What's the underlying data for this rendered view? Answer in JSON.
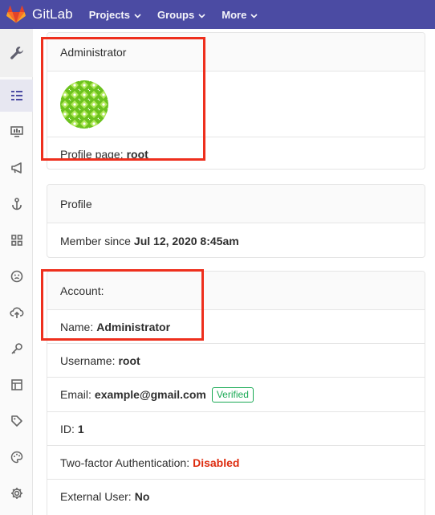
{
  "app": {
    "name": "GitLab",
    "brand_color": "#4b4ba3",
    "logo_icon": "gitlab-tanuki-icon"
  },
  "nav": {
    "items": [
      {
        "label": "Projects"
      },
      {
        "label": "Groups"
      },
      {
        "label": "More"
      }
    ]
  },
  "sidebar": {
    "icons": [
      "wrench-icon",
      "overview-icon",
      "monitor-icon",
      "megaphone-icon",
      "hook-icon",
      "apps-icon",
      "abuse-face-icon",
      "cloud-icon",
      "key-icon",
      "layout-icon",
      "label-icon",
      "palette-icon",
      "settings-gear-icon"
    ]
  },
  "user_card": {
    "header": "Administrator",
    "profile_label": "Profile page:",
    "profile_value": "root"
  },
  "profile_card": {
    "header": "Profile",
    "member_label": "Member since",
    "member_value": "Jul 12, 2020 8:45am"
  },
  "account_card": {
    "header": "Account:",
    "name_label": "Name:",
    "name_value": "Administrator",
    "username_label": "Username:",
    "username_value": "root",
    "email_label": "Email:",
    "email_value": "example@gmail.com",
    "email_badge": "Verified",
    "id_label": "ID:",
    "id_value": "1",
    "twofa_label": "Two-factor Authentication:",
    "twofa_value": "Disabled",
    "external_label": "External User:",
    "external_value": "No"
  },
  "colors": {
    "danger": "#dd2b0e",
    "success": "#1aaa55",
    "highlight": "#ee2f1d"
  }
}
